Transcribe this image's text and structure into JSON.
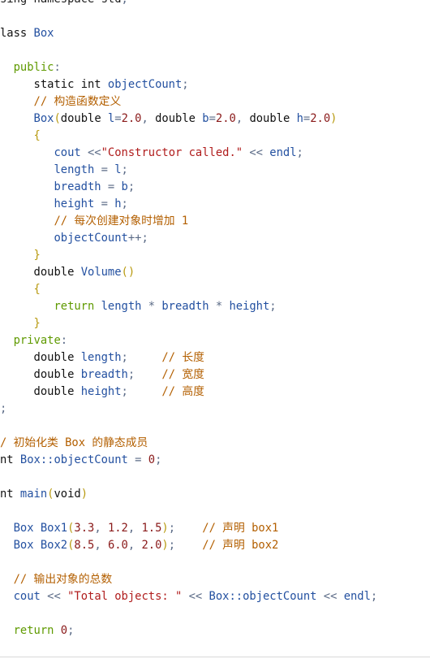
{
  "colors": {
    "keyword": "#111111",
    "identifier": "#2350a0",
    "number": "#8a1a1a",
    "string": "#b01c1c",
    "comment": "#b35f00",
    "access": "#5f9a00",
    "paren": "#b89a10",
    "operator": "#5a6a86"
  },
  "code_lines": [
    [
      [
        "t",
        "sing namespace std"
      ],
      [
        "op",
        ";"
      ]
    ],
    [],
    [
      [
        "k",
        "lass "
      ],
      [
        "id",
        "Box"
      ]
    ],
    [],
    [
      [
        "t",
        "  "
      ],
      [
        "g",
        "public"
      ],
      [
        "op",
        ":"
      ]
    ],
    [
      [
        "t",
        "     "
      ],
      [
        "k",
        "static int "
      ],
      [
        "id",
        "objectCount"
      ],
      [
        "op",
        ";"
      ]
    ],
    [
      [
        "t",
        "     "
      ],
      [
        "c",
        "// 构造函数定义"
      ]
    ],
    [
      [
        "t",
        "     "
      ],
      [
        "id",
        "Box"
      ],
      [
        "p",
        "("
      ],
      [
        "k",
        "double "
      ],
      [
        "id",
        "l"
      ],
      [
        "op",
        "="
      ],
      [
        "num",
        "2.0"
      ],
      [
        "op",
        ", "
      ],
      [
        "k",
        "double "
      ],
      [
        "id",
        "b"
      ],
      [
        "op",
        "="
      ],
      [
        "num",
        "2.0"
      ],
      [
        "op",
        ", "
      ],
      [
        "k",
        "double "
      ],
      [
        "id",
        "h"
      ],
      [
        "op",
        "="
      ],
      [
        "num",
        "2.0"
      ],
      [
        "p",
        ")"
      ]
    ],
    [
      [
        "t",
        "     "
      ],
      [
        "p",
        "{"
      ]
    ],
    [
      [
        "t",
        "        "
      ],
      [
        "id",
        "cout "
      ],
      [
        "op",
        "<<"
      ],
      [
        "str",
        "\"Constructor called.\""
      ],
      [
        "op",
        " << "
      ],
      [
        "id",
        "endl"
      ],
      [
        "op",
        ";"
      ]
    ],
    [
      [
        "t",
        "        "
      ],
      [
        "id",
        "length"
      ],
      [
        "op",
        " = "
      ],
      [
        "id",
        "l"
      ],
      [
        "op",
        ";"
      ]
    ],
    [
      [
        "t",
        "        "
      ],
      [
        "id",
        "breadth"
      ],
      [
        "op",
        " = "
      ],
      [
        "id",
        "b"
      ],
      [
        "op",
        ";"
      ]
    ],
    [
      [
        "t",
        "        "
      ],
      [
        "id",
        "height"
      ],
      [
        "op",
        " = "
      ],
      [
        "id",
        "h"
      ],
      [
        "op",
        ";"
      ]
    ],
    [
      [
        "t",
        "        "
      ],
      [
        "c",
        "// 每次创建对象时增加 1"
      ]
    ],
    [
      [
        "t",
        "        "
      ],
      [
        "id",
        "objectCount"
      ],
      [
        "op",
        "++;"
      ]
    ],
    [
      [
        "t",
        "     "
      ],
      [
        "p",
        "}"
      ]
    ],
    [
      [
        "t",
        "     "
      ],
      [
        "k",
        "double "
      ],
      [
        "id",
        "Volume"
      ],
      [
        "p",
        "()"
      ]
    ],
    [
      [
        "t",
        "     "
      ],
      [
        "p",
        "{"
      ]
    ],
    [
      [
        "t",
        "        "
      ],
      [
        "g",
        "return "
      ],
      [
        "id",
        "length"
      ],
      [
        "op",
        " * "
      ],
      [
        "id",
        "breadth"
      ],
      [
        "op",
        " * "
      ],
      [
        "id",
        "height"
      ],
      [
        "op",
        ";"
      ]
    ],
    [
      [
        "t",
        "     "
      ],
      [
        "p",
        "}"
      ]
    ],
    [
      [
        "t",
        "  "
      ],
      [
        "g",
        "private"
      ],
      [
        "op",
        ":"
      ]
    ],
    [
      [
        "t",
        "     "
      ],
      [
        "k",
        "double "
      ],
      [
        "id",
        "length"
      ],
      [
        "op",
        ";"
      ],
      [
        "t",
        "     "
      ],
      [
        "c",
        "// 长度"
      ]
    ],
    [
      [
        "t",
        "     "
      ],
      [
        "k",
        "double "
      ],
      [
        "id",
        "breadth"
      ],
      [
        "op",
        ";"
      ],
      [
        "t",
        "    "
      ],
      [
        "c",
        "// 宽度"
      ]
    ],
    [
      [
        "t",
        "     "
      ],
      [
        "k",
        "double "
      ],
      [
        "id",
        "height"
      ],
      [
        "op",
        ";"
      ],
      [
        "t",
        "     "
      ],
      [
        "c",
        "// 高度"
      ]
    ],
    [
      [
        "op",
        ";"
      ]
    ],
    [],
    [
      [
        "c",
        "/ 初始化类 Box 的静态成员"
      ]
    ],
    [
      [
        "k",
        "nt "
      ],
      [
        "id",
        "Box::objectCount"
      ],
      [
        "op",
        " = "
      ],
      [
        "num",
        "0"
      ],
      [
        "op",
        ";"
      ]
    ],
    [],
    [
      [
        "k",
        "nt "
      ],
      [
        "id",
        "main"
      ],
      [
        "p",
        "("
      ],
      [
        "k",
        "void"
      ],
      [
        "p",
        ")"
      ]
    ],
    [],
    [
      [
        "t",
        "  "
      ],
      [
        "id",
        "Box Box1"
      ],
      [
        "p",
        "("
      ],
      [
        "num",
        "3.3"
      ],
      [
        "op",
        ", "
      ],
      [
        "num",
        "1.2"
      ],
      [
        "op",
        ", "
      ],
      [
        "num",
        "1.5"
      ],
      [
        "p",
        ")"
      ],
      [
        "op",
        ";"
      ],
      [
        "t",
        "    "
      ],
      [
        "c",
        "// 声明 box1"
      ]
    ],
    [
      [
        "t",
        "  "
      ],
      [
        "id",
        "Box Box2"
      ],
      [
        "p",
        "("
      ],
      [
        "num",
        "8.5"
      ],
      [
        "op",
        ", "
      ],
      [
        "num",
        "6.0"
      ],
      [
        "op",
        ", "
      ],
      [
        "num",
        "2.0"
      ],
      [
        "p",
        ")"
      ],
      [
        "op",
        ";"
      ],
      [
        "t",
        "    "
      ],
      [
        "c",
        "// 声明 box2"
      ]
    ],
    [],
    [
      [
        "t",
        "  "
      ],
      [
        "c",
        "// 输出对象的总数"
      ]
    ],
    [
      [
        "t",
        "  "
      ],
      [
        "id",
        "cout"
      ],
      [
        "op",
        " << "
      ],
      [
        "str",
        "\"Total objects: \""
      ],
      [
        "op",
        " << "
      ],
      [
        "id",
        "Box::objectCount"
      ],
      [
        "op",
        " << "
      ],
      [
        "id",
        "endl"
      ],
      [
        "op",
        ";"
      ]
    ],
    [],
    [
      [
        "t",
        "  "
      ],
      [
        "g",
        "return "
      ],
      [
        "num",
        "0"
      ],
      [
        "op",
        ";"
      ]
    ]
  ]
}
